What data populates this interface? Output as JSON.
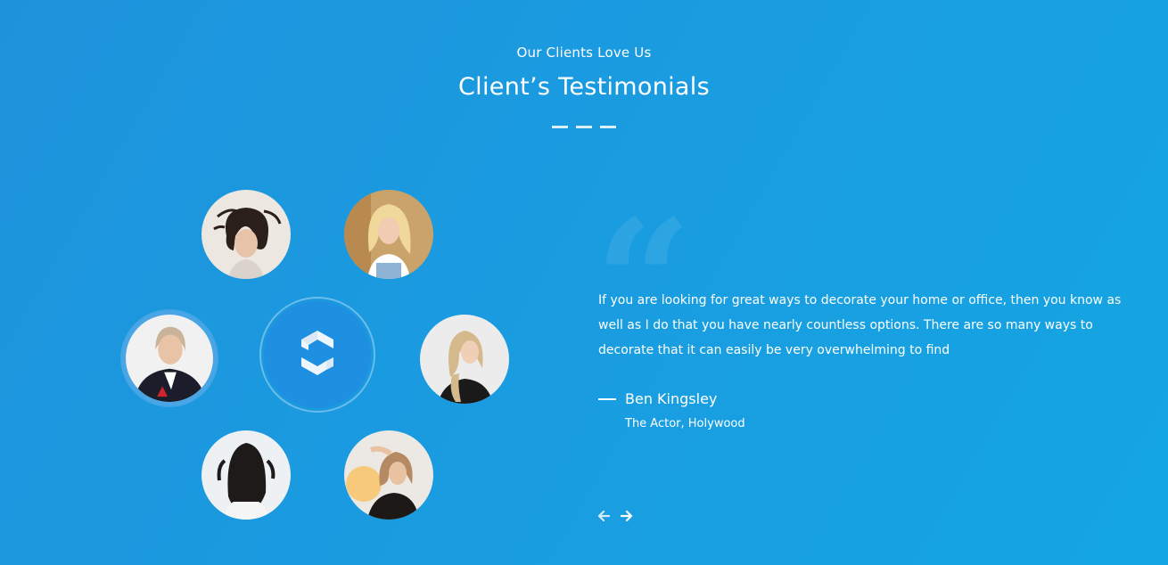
{
  "header": {
    "eyebrow": "Our Clients Love Us",
    "title": "Client’s Testimonials"
  },
  "testimonial": {
    "quote": "If you are looking for great ways to decorate your home or office, then you know as well as I do that you have nearly countless options. There are so many ways to decorate that it can easily be very overwhelming to find",
    "author_name": "Ben Kingsley",
    "author_role": "The Actor, Holywood"
  },
  "avatars": [
    {
      "name": "client-avatar-1",
      "active": false
    },
    {
      "name": "client-avatar-2",
      "active": false
    },
    {
      "name": "client-avatar-3",
      "active": true
    },
    {
      "name": "client-avatar-4",
      "active": false
    },
    {
      "name": "client-avatar-5",
      "active": false
    },
    {
      "name": "client-avatar-6",
      "active": false
    }
  ],
  "icons": {
    "quote": "quote-icon",
    "logo": "brand-logo-icon",
    "prev": "arrow-left-icon",
    "next": "arrow-right-icon"
  },
  "colors": {
    "background_start": "#1e93dc",
    "background_end": "#14a6e3",
    "logo_fill": "#1f8fe2",
    "active_ring": "#4aa5e6",
    "text": "#ffffff"
  }
}
